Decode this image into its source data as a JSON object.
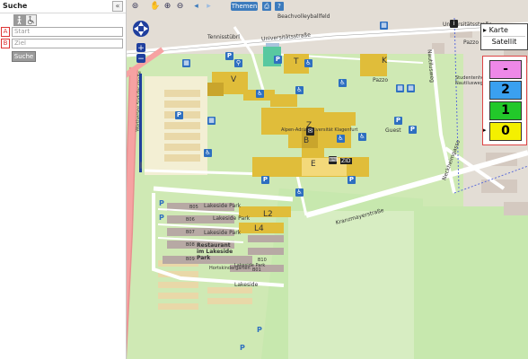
{
  "sidebar": {
    "title": "Suche",
    "collapse_glyph": "«",
    "modes": {
      "walk_icon": "walking-person-icon",
      "wheel_icon": "wheelchair-icon"
    },
    "start": {
      "badge": "A",
      "placeholder": "Start"
    },
    "ziel": {
      "badge": "B",
      "placeholder": "Ziel"
    },
    "search_label": "Suche"
  },
  "toolbar": {
    "themen_label": "Themen"
  },
  "layers": {
    "karte": "Karte",
    "satellit": "Satellit",
    "active_marker": "▸"
  },
  "floors": [
    {
      "label": "-",
      "color": "#ee88e8"
    },
    {
      "label": "2",
      "color": "#3aa0f0"
    },
    {
      "label": "1",
      "color": "#22c82a"
    },
    {
      "label": "0",
      "color": "#f4f000"
    }
  ],
  "map_labels": {
    "street_universitaet": "Universitätsstraße",
    "street_universitaet_right": "Universitätsstraße",
    "street_krastowitzer": "Kranzmayerstraße",
    "street_woerthersee": "Wörthersee Südufer straße",
    "street_lakeside": "Lakeside",
    "street_lakeside_park1": "Lakeside Park",
    "street_lakeside_park2": "Lakeside Park",
    "street_lakeside_park3": "Lakeside Park",
    "street_lakeside_park4": "Lakeside Park",
    "street_nautilusweg": "Nautilusweg",
    "street_neckheimgasse": "Neckheimgasse",
    "tennisstuebrl": "Tennisstübrl",
    "beach_volleyball": "Beachvolleyballfeld",
    "pazzo": "Pazzo",
    "pazzo2": "Pazzo",
    "alpen_adria": "Alpen-Adria Universität Klagenfurt",
    "guest": "Guest",
    "studentenheim": "Studentenheim Nautilusweg",
    "restaurant": "Restaurant im Lakeside Park",
    "kindergarten": "Hortskindergarten",
    "zid": "ZID",
    "bld_V": "V",
    "bld_T": "T",
    "bld_K": "K",
    "bld_Z": "Z",
    "bld_B": "B",
    "bld_E": "E",
    "bld_L2": "L2",
    "bld_L4": "L4",
    "b05": "B05",
    "b06": "B06",
    "b07": "B07",
    "b08": "B08",
    "b09": "B09",
    "b10": "B10",
    "b01": "B01"
  }
}
